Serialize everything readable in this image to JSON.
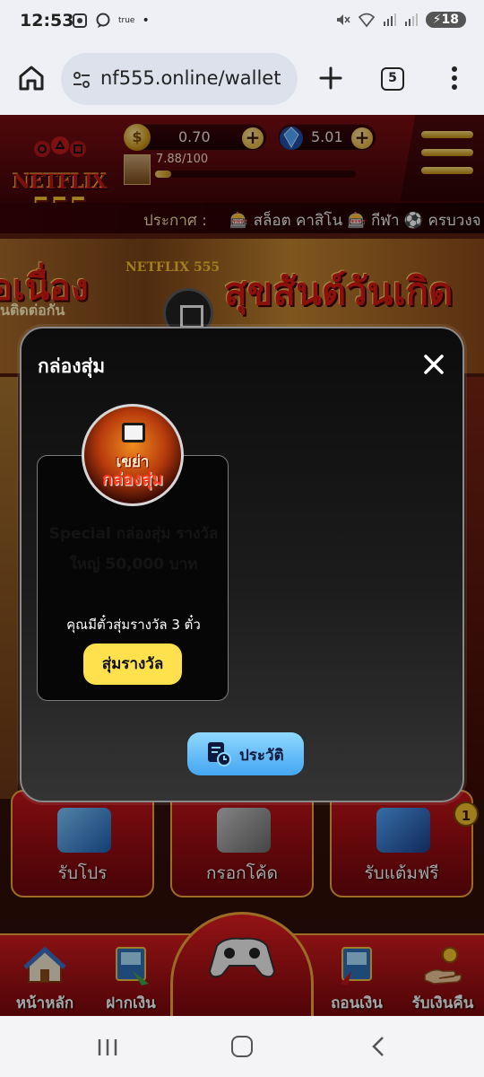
{
  "status_bar": {
    "time": "12:53",
    "mini_label": "true",
    "battery": "18"
  },
  "browser": {
    "url": "nf555.online/wallet",
    "tab_count": "5"
  },
  "site_header": {
    "logo_top": "NETFLIX",
    "logo_bottom": "555",
    "coin_balance": "0.70",
    "gem_balance": "5.01",
    "level_text": "7.88/100",
    "level_progress": 0.0788,
    "announce_label": "ประกาศ :",
    "announce_text": "🎰 สล็อต คาสิโน 🎰 กีฬา ⚽ ครบวงจ"
  },
  "background": {
    "banner_left_text": "อเนื่อง",
    "banner_left_sub": "นติดต่อกัน",
    "banner_small_logo": "NETFLIX 555",
    "banner_right_text": "สุขสันต์วันเกิด",
    "tiles": [
      {
        "label": "รับโปร"
      },
      {
        "label": "กรอกโค้ด"
      },
      {
        "label": "รับแต้มฟรี"
      }
    ],
    "notification_count": "1"
  },
  "bottom_nav": {
    "items": [
      {
        "label": "หน้าหลัก"
      },
      {
        "label": "ฝากเงิน"
      },
      {
        "label": "ถอนเงิน"
      },
      {
        "label": "รับเงินคืน"
      }
    ]
  },
  "modal": {
    "title": "กล่องสุ่ม",
    "box": {
      "image_title": "เขย่า",
      "image_subtitle": "กล่องสุ่ม",
      "name": "Special กล่องสุ่ม รางวัลใหญ่ 50,000 บาท",
      "tickets_text": "คุณมีตั๋วสุ่มรางวัล 3 ตั๋ว",
      "draw_label": "สุ่มรางวัล"
    },
    "history_label": "ประวัติ"
  },
  "colors": {
    "draw_button": "#ffe14d",
    "history_button": "#6ec2f9",
    "header_red": "#7a0e12",
    "gold": "#f2c12e"
  }
}
